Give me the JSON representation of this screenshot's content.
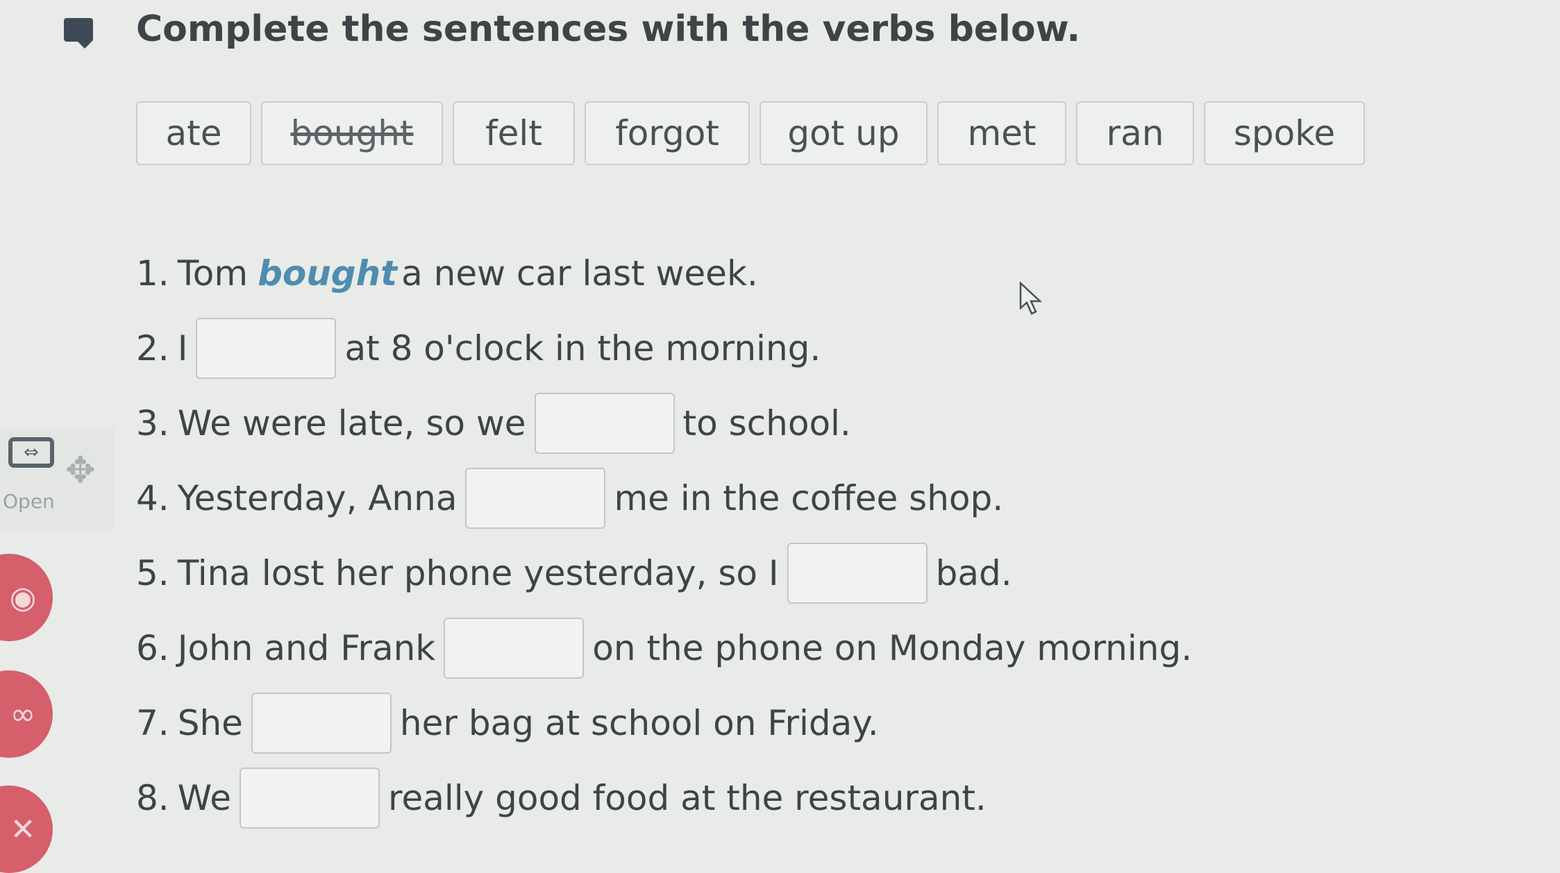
{
  "instruction": "Complete the sentences with the verbs below.",
  "word_bank": [
    {
      "word": "ate",
      "used": false
    },
    {
      "word": "bought",
      "used": true
    },
    {
      "word": "felt",
      "used": false
    },
    {
      "word": "forgot",
      "used": false
    },
    {
      "word": "got up",
      "used": false
    },
    {
      "word": "met",
      "used": false
    },
    {
      "word": "ran",
      "used": false
    },
    {
      "word": "spoke",
      "used": false
    }
  ],
  "sentences": [
    {
      "num": "1.",
      "before": "Tom",
      "answer": "bought",
      "after": "a new car last week."
    },
    {
      "num": "2.",
      "before": "I",
      "answer": "",
      "after": "at 8 o'clock in the morning."
    },
    {
      "num": "3.",
      "before": "We were late, so we",
      "answer": "",
      "after": "to school."
    },
    {
      "num": "4.",
      "before": "Yesterday, Anna",
      "answer": "",
      "after": "me in the coffee shop."
    },
    {
      "num": "5.",
      "before": "Tina lost her phone yesterday, so I",
      "answer": "",
      "after": "bad."
    },
    {
      "num": "6.",
      "before": "John and Frank",
      "answer": "",
      "after": "on the phone on Monday morning."
    },
    {
      "num": "7.",
      "before": "She",
      "answer": "",
      "after": "her bag at school on Friday."
    },
    {
      "num": "8.",
      "before": "We",
      "answer": "",
      "after": "really good food at the restaurant."
    }
  ],
  "side_panel": {
    "open_label": "Open",
    "open_icon": "open-panel-icon",
    "move_icon": "move-icon"
  },
  "side_buttons": [
    {
      "icon": "record-icon",
      "glyph": "◉"
    },
    {
      "icon": "shuffle-icon",
      "glyph": "∞"
    },
    {
      "icon": "close-icon",
      "glyph": "✕"
    }
  ],
  "colors": {
    "filled_answer": "#4e8db0",
    "side_button": "#d55f6b"
  }
}
